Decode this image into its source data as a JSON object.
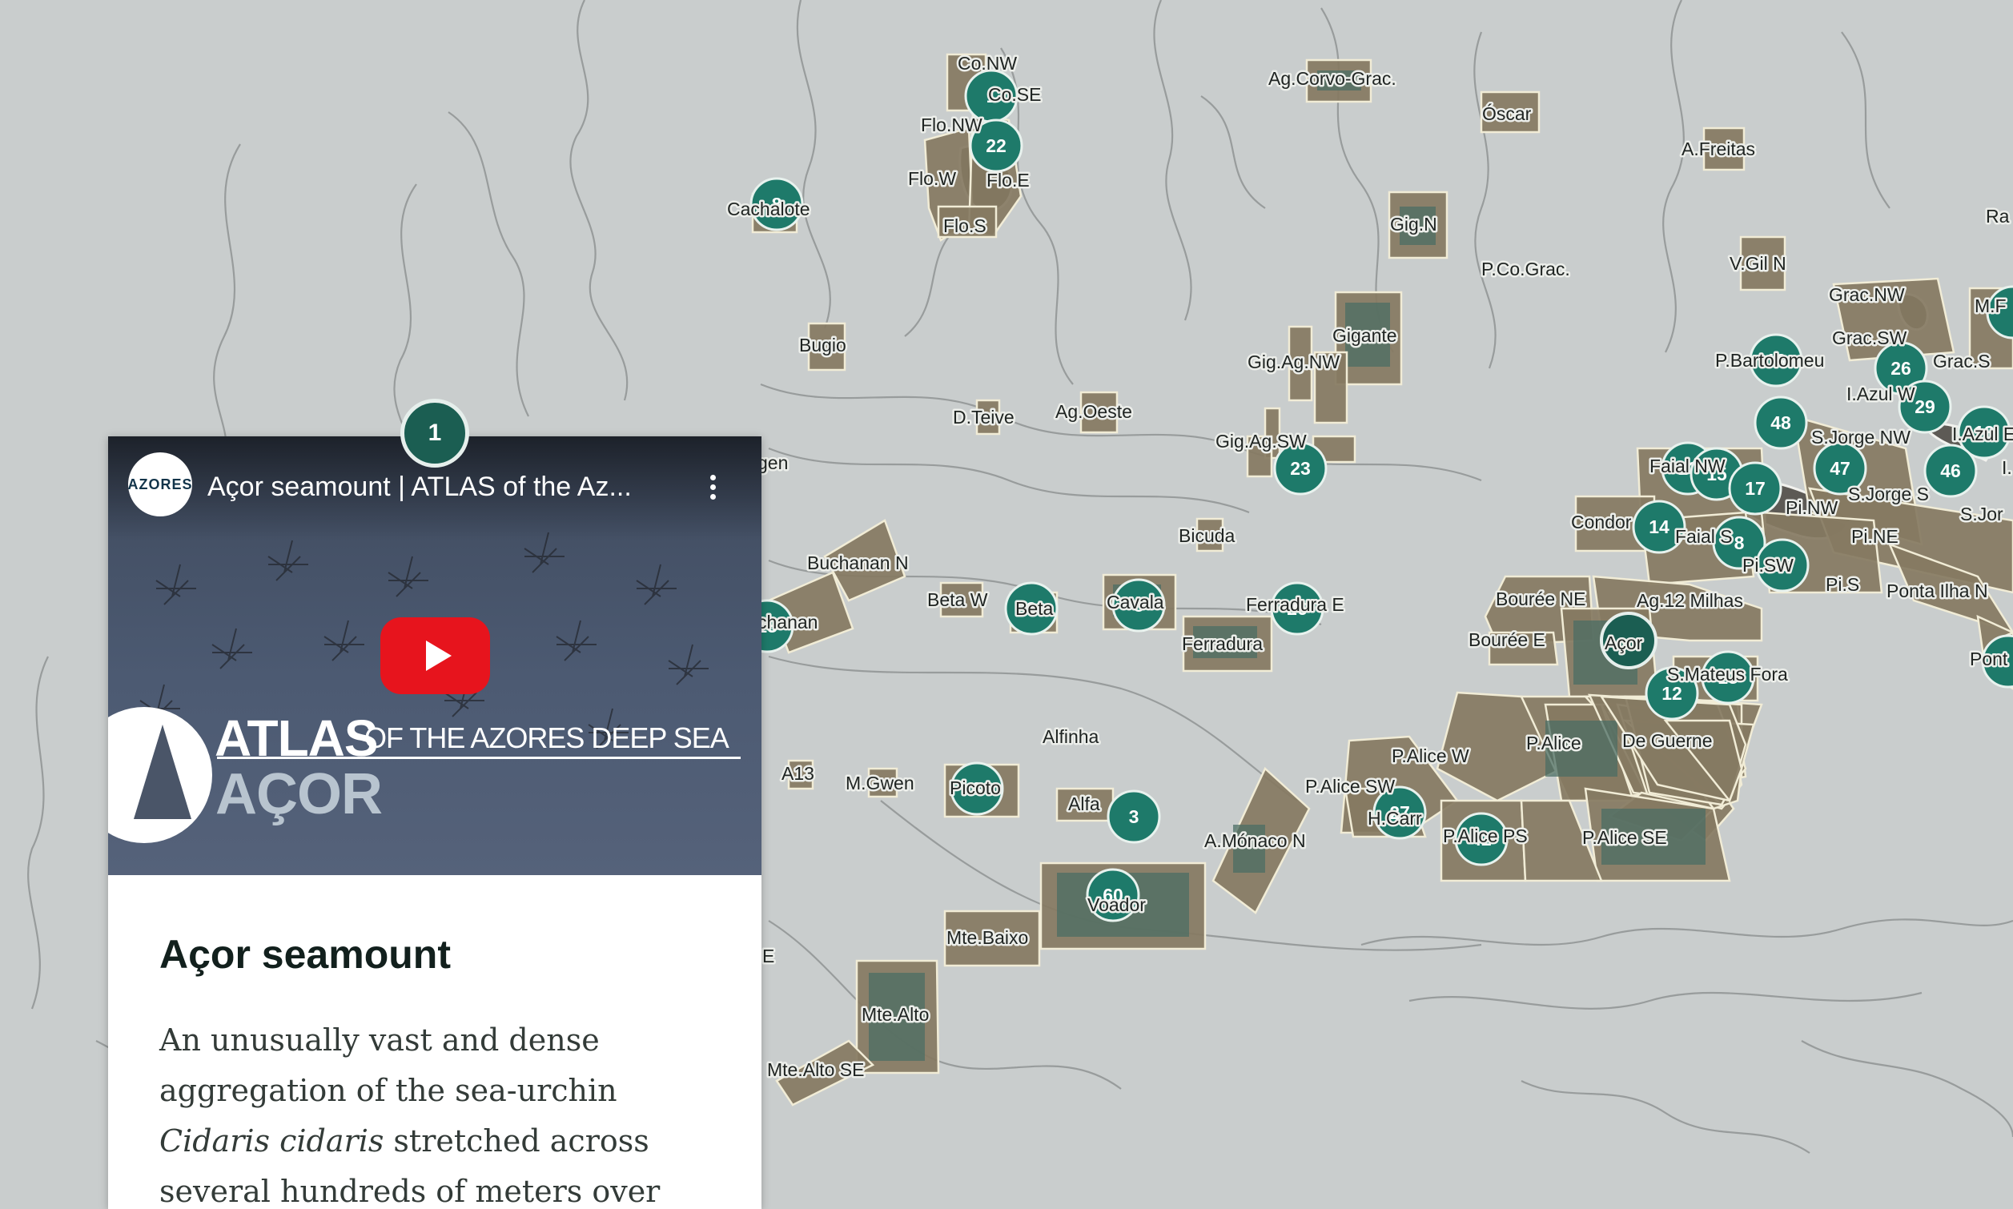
{
  "map": {
    "labels": {
      "co_nw": "Co.NW",
      "co_se": "Co.SE",
      "ag_corvo_grac": "Ag.Corvo-Grac.",
      "oscar": "Óscar",
      "a_freitas": "A.Freitas",
      "flo_nw": "Flo.NW",
      "flo_w": "Flo.W",
      "flo_e": "Flo.E",
      "flo_s": "Flo.S",
      "cachalote": "Cachalote",
      "gig_n": "Gig.N",
      "p_co_grac": "P.Co.Grac.",
      "v_gil_n": "V.Gil N",
      "ra": "Ra",
      "grac_nw": "Grac.NW",
      "m_f": "M.F",
      "gigante": "Gigante",
      "gig_ag_nw": "Gig.Ag.NW",
      "bugio": "Bugio",
      "grac_sw": "Grac.SW",
      "grac_s": "Grac.S",
      "p_bartolomeu": "P.Bartolomeu",
      "i_azul_w": "I.Azul W",
      "i_azul_e": "I.Azul E",
      "d_teive": "D.Teive",
      "ag_oeste": "Ag.Oeste",
      "s_jorge_nw": "S.Jorge NW",
      "gig_ag_sw": "Gig.Ag.SW",
      "gen": "gen",
      "faial_nw": "Faial NW",
      "i_edge": "I.",
      "s_jorge_s": "S.Jorge S",
      "pi_nw": "Pi.NW",
      "s_jor": "S.Jor",
      "condor": "Condor",
      "faial_s": "Faial S",
      "bicuda": "Bicuda",
      "pi_ne": "Pi.NE",
      "buchanan_n": "Buchanan N",
      "pi_sw": "Pi.SW",
      "pi_s": "Pi.S",
      "ponta_ilha_n": "Ponta Ilha N",
      "beta_w": "Beta W",
      "beta": "Beta",
      "cavala": "Cavala",
      "ferradura_e": "Ferradura E",
      "bouree_ne": "Bourée NE",
      "ag_12_milhas": "Ag.12 Milhas",
      "chanan": "chanan",
      "bouree_e": "Bourée E",
      "ferradura": "Ferradura",
      "acor": "Açor",
      "pont": "Pont",
      "s_mateus_fora": "S.Mateus Fora",
      "alfinha": "Alfinha",
      "de_guerne": "De Guerne",
      "p_alice": "P.Alice",
      "p_alice_w": "P.Alice W",
      "a13": "A13",
      "m_gwen": "M.Gwen",
      "p_alice_sw": "P.Alice SW",
      "picoto": "Picoto",
      "alfa": "Alfa",
      "h_carr": "H.Carr",
      "a_monaco_n": "A.Mónaco N",
      "p_alice_ps": "P.Alice PS",
      "p_alice_se": "P.Alice SE",
      "voador": "Voador",
      "mte_baixo": "Mte.Baixo",
      "e_edge": "E",
      "mte_alto": "Mte.Alto",
      "mte_alto_se": "Mte.Alto SE"
    },
    "clusters": {
      "c1": "1",
      "c22": "22",
      "c23": "23",
      "c48": "48",
      "c29": "29",
      "c47": "47",
      "c46": "46",
      "c15": "15",
      "c17": "17",
      "c14": "14",
      "c8": "8",
      "c12": "12",
      "c3": "3",
      "c60": "60",
      "c42": "42",
      "c27": "27",
      "c26": "26",
      "c13": "13"
    },
    "colors": {
      "area_fill": "#857a62",
      "area_border": "#f1ecd6",
      "cluster": "#1e7a6a",
      "sea": "#c9cdcd"
    }
  },
  "selected_pin": {
    "count": "1"
  },
  "popup": {
    "video": {
      "channel_logo_text": "AZORES",
      "title": "Açor seamount | ATLAS of the Az...",
      "overlay_atlas": "ATLAS",
      "overlay_sub": "OF THE AZORES DEEP SEA",
      "overlay_name": "AÇOR",
      "menu_icon": "more-vertical-icon",
      "play_icon": "youtube-play-icon"
    },
    "title": "Açor seamount",
    "description": {
      "part1": "An unusually vast and dense aggregation of the sea-urchin ",
      "species": "Cidaris cidaris",
      "part2": " stretched across several hundreds of meters over soft"
    }
  }
}
